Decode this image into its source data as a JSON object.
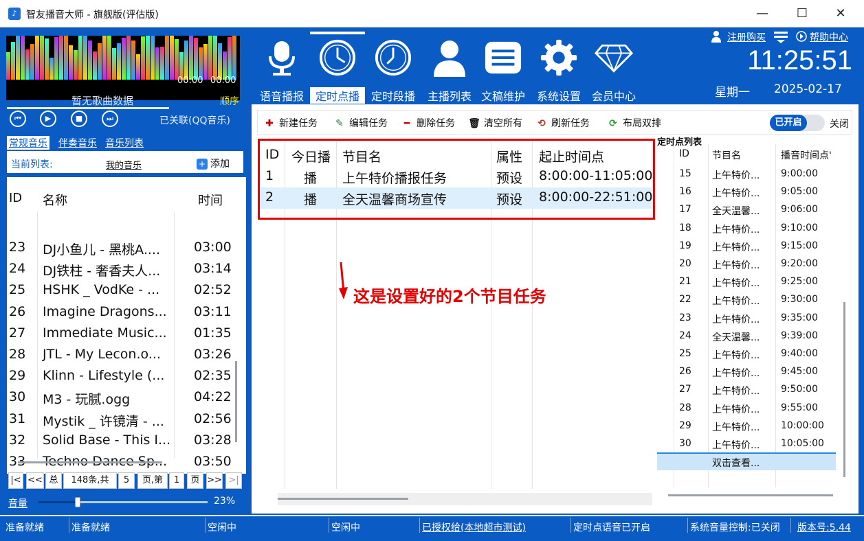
{
  "window": {
    "title": "智友播音大师 - 旗舰版(评估版)",
    "minimize": "—",
    "maximize": "☐",
    "close": "✕"
  },
  "player": {
    "elapsed": "00:00",
    "total": "00:00",
    "no_song": "暂无歌曲数据",
    "order": "顺序",
    "qq_link": "已关联(QQ音乐)",
    "controls": [
      "⏮",
      "▶",
      "■",
      "⏭"
    ]
  },
  "music_tabs": [
    "常规音乐",
    "伴奏音乐",
    "音乐列表"
  ],
  "current_list": {
    "label": "当前列表:",
    "name": "我的音乐",
    "add": "添加"
  },
  "song_list": {
    "headers": {
      "id": "ID",
      "name": "名称",
      "time": "时间"
    },
    "rows": [
      {
        "id": "23",
        "name": "DJ小鱼儿 - 黑桃A....",
        "time": "03:00"
      },
      {
        "id": "24",
        "name": "DJ铁柱 - 奢香夫人...",
        "time": "03:14"
      },
      {
        "id": "25",
        "name": "HSHK _ VodKe - ...",
        "time": "02:52"
      },
      {
        "id": "26",
        "name": "Imagine Dragons...",
        "time": "03:11"
      },
      {
        "id": "27",
        "name": "Immediate Music...",
        "time": "01:35"
      },
      {
        "id": "28",
        "name": "JTL - My Lecon.o...",
        "time": "03:26"
      },
      {
        "id": "29",
        "name": "Klinn - Lifestyle (...",
        "time": "02:35"
      },
      {
        "id": "30",
        "name": "M3 - 玩腻.ogg",
        "time": "04:22"
      },
      {
        "id": "31",
        "name": "Mystik _ 许镜清 - ...",
        "time": "02:56"
      },
      {
        "id": "32",
        "name": "Solid Base - This I...",
        "time": "03:28"
      },
      {
        "id": "33",
        "name": "Techno Dance Sp...",
        "time": "03:50"
      }
    ]
  },
  "pager": {
    "first": "|<",
    "prev": "<<",
    "total_label": "总",
    "count": "148条,共",
    "pages": "5",
    "page_label": "页,第",
    "current": "1",
    "page_suffix": "页",
    "next": ">>",
    "last": ">|"
  },
  "volume": {
    "label": "音量",
    "percent": "23%",
    "value": 0.23
  },
  "nav": [
    {
      "label": "语音播报",
      "icon": "microphone-icon"
    },
    {
      "label": "定时点播",
      "icon": "clock-icon",
      "active": true
    },
    {
      "label": "定时段播",
      "icon": "clock-icon"
    },
    {
      "label": "主播列表",
      "icon": "person-icon"
    },
    {
      "label": "文稿维护",
      "icon": "document-icon"
    },
    {
      "label": "系统设置",
      "icon": "gear-icon"
    },
    {
      "label": "会员中心",
      "icon": "diamond-icon"
    }
  ],
  "header": {
    "register": "注册购买",
    "help": "帮助中心",
    "clock": "11:25:51",
    "weekday": "星期一",
    "date": "2025-02-17"
  },
  "toolbar": {
    "new_task": "新建任务",
    "edit_task": "编辑任务",
    "delete_task": "删除任务",
    "clear_all": "清空所有",
    "refresh_task": "刷新任务",
    "layout_dual": "布局双排",
    "toggle_on": "已开启",
    "toggle_off": "关闭"
  },
  "task_table": {
    "headers": {
      "id": "ID",
      "today": "今日播",
      "name": "节目名",
      "attr": "属性",
      "time": "起止时间点"
    },
    "rows": [
      {
        "id": "1",
        "today": "播",
        "name": "上午特价播报任务",
        "attr": "预设",
        "time": "8:00:00-11:05:00"
      },
      {
        "id": "2",
        "today": "播",
        "name": "全天温馨商场宣传",
        "attr": "预设",
        "time": "8:00:00-22:51:00"
      }
    ],
    "annotation": "这是设置好的2个节目任务"
  },
  "timepoint_list": {
    "title": "定时点列表",
    "headers": {
      "id": "ID",
      "name": "节目名",
      "time": "播音时间点'"
    },
    "rows": [
      {
        "id": "15",
        "name": "上午特价...",
        "time": "9:00:00"
      },
      {
        "id": "16",
        "name": "上午特价...",
        "time": "9:05:00"
      },
      {
        "id": "17",
        "name": "全天温馨...",
        "time": "9:06:00"
      },
      {
        "id": "18",
        "name": "上午特价...",
        "time": "9:10:00"
      },
      {
        "id": "19",
        "name": "上午特价...",
        "time": "9:15:00"
      },
      {
        "id": "20",
        "name": "上午特价...",
        "time": "9:20:00"
      },
      {
        "id": "21",
        "name": "上午特价...",
        "time": "9:25:00"
      },
      {
        "id": "22",
        "name": "上午特价...",
        "time": "9:30:00"
      },
      {
        "id": "23",
        "name": "上午特价...",
        "time": "9:35:00"
      },
      {
        "id": "24",
        "name": "全天温馨...",
        "time": "9:39:00"
      },
      {
        "id": "25",
        "name": "上午特价...",
        "time": "9:40:00"
      },
      {
        "id": "26",
        "name": "上午特价...",
        "time": "9:45:00"
      },
      {
        "id": "27",
        "name": "上午特价...",
        "time": "9:50:00"
      },
      {
        "id": "28",
        "name": "上午特价...",
        "time": "9:55:00"
      },
      {
        "id": "29",
        "name": "上午特价...",
        "time": "10:00:00"
      },
      {
        "id": "30",
        "name": "上午特价...",
        "time": "10:05:00"
      }
    ],
    "more": "双击查看..."
  },
  "status": {
    "s1": "准备就绪",
    "s2": "准备就绪",
    "s3": "空闲中",
    "s4": "空闲中",
    "license": "已授权给(本地超市测试)",
    "voice": "定时点语音已开启",
    "sys_volume": "系统音量控制:已关闭",
    "version": "版本号:5.44"
  },
  "colors": {
    "brand_blue": "#0a5bc4",
    "annotation_red": "#e20000",
    "order_yellow": "#f2e300"
  }
}
